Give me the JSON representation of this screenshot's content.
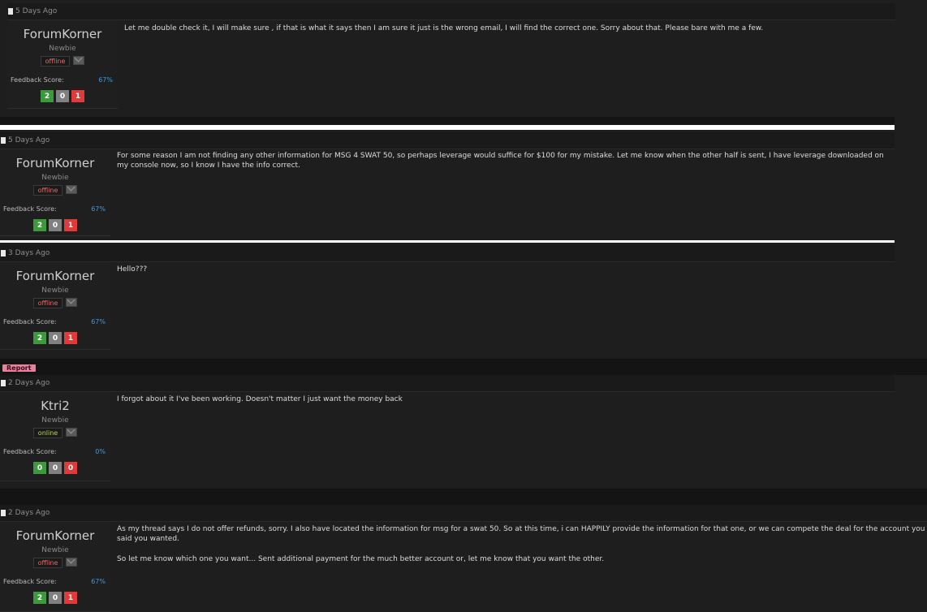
{
  "posts": [
    {
      "time": "5 Days Ago",
      "user": {
        "name": "ForumKorner",
        "rank": "Newbie",
        "status": "offline",
        "feedback_label": "Feedback Score:",
        "feedback_pct": "67%",
        "scores": [
          "2",
          "0",
          "1"
        ]
      },
      "message": [
        "Let me double check it, I will make sure , if that is what it says then I am sure it just is the wrong email, I will find the correct one. Sorry about that. Please bare with me a few."
      ]
    },
    {
      "time": "5 Days Ago",
      "user": {
        "name": "ForumKorner",
        "rank": "Newbie",
        "status": "offline",
        "feedback_label": "Feedback Score:",
        "feedback_pct": "67%",
        "scores": [
          "2",
          "0",
          "1"
        ]
      },
      "message": [
        "For some reason I am not finding any other information for MSG 4 SWAT 50, so perhaps leverage would suffice for $100 for my mistake. Let me know when the other half is sent, I have leverage downloaded on my console now, so I know I have the info correct."
      ]
    },
    {
      "time": "3 Days Ago",
      "user": {
        "name": "ForumKorner",
        "rank": "Newbie",
        "status": "offline",
        "feedback_label": "Feedback Score:",
        "feedback_pct": "67%",
        "scores": [
          "2",
          "0",
          "1"
        ]
      },
      "message": [
        "Hello???"
      ]
    },
    {
      "time": "2 Days Ago",
      "user": {
        "name": "Ktri2",
        "rank": "Newbie",
        "status": "online",
        "feedback_label": "Feedback Score:",
        "feedback_pct": "0%",
        "scores": [
          "0",
          "0",
          "0"
        ]
      },
      "message": [
        "I forgot about it I've been working. Doesn't matter I just want the money back"
      ]
    },
    {
      "time": "2 Days Ago",
      "user": {
        "name": "ForumKorner",
        "rank": "Newbie",
        "status": "offline",
        "feedback_label": "Feedback Score:",
        "feedback_pct": "67%",
        "scores": [
          "2",
          "0",
          "1"
        ]
      },
      "message": [
        "As my thread says I do not offer refunds, sorry. I also have located the information for msg for a swat 50. So at this time, i can HAPPILY provide the information for that one, or we can compete the deal for the account you said you wanted.",
        "So let me know which one you want... Sent additional payment for the much better account or, let me know that you want the other."
      ]
    }
  ],
  "report_label": "Report"
}
